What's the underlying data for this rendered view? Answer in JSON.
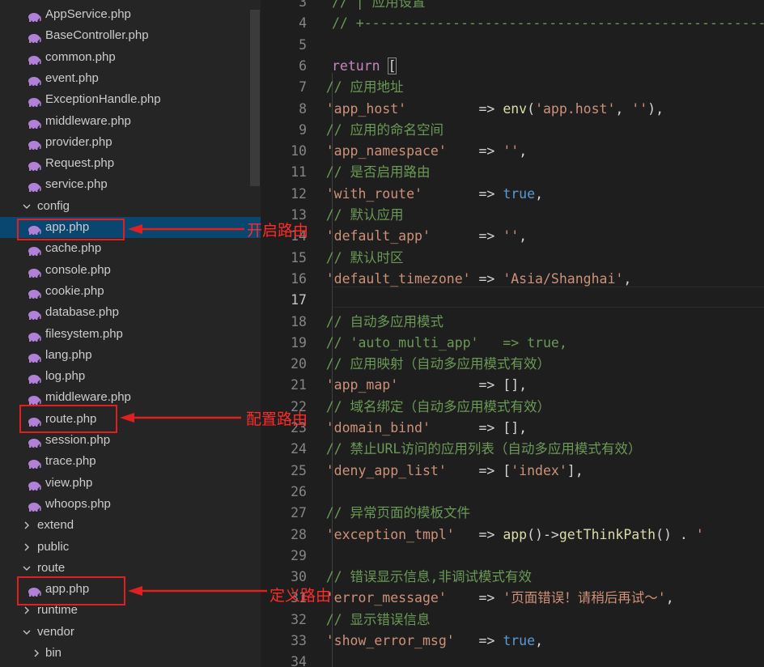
{
  "explorer": {
    "items": [
      {
        "label": "AppService.php",
        "type": "file",
        "depth": 2
      },
      {
        "label": "BaseController.php",
        "type": "file",
        "depth": 2
      },
      {
        "label": "common.php",
        "type": "file",
        "depth": 2
      },
      {
        "label": "event.php",
        "type": "file",
        "depth": 2
      },
      {
        "label": "ExceptionHandle.php",
        "type": "file",
        "depth": 2
      },
      {
        "label": "middleware.php",
        "type": "file",
        "depth": 2
      },
      {
        "label": "provider.php",
        "type": "file",
        "depth": 2
      },
      {
        "label": "Request.php",
        "type": "file",
        "depth": 2
      },
      {
        "label": "service.php",
        "type": "file",
        "depth": 2
      },
      {
        "label": "config",
        "type": "folder",
        "open": true,
        "depth": 1
      },
      {
        "label": "app.php",
        "type": "file",
        "depth": 2,
        "selected": true
      },
      {
        "label": "cache.php",
        "type": "file",
        "depth": 2
      },
      {
        "label": "console.php",
        "type": "file",
        "depth": 2
      },
      {
        "label": "cookie.php",
        "type": "file",
        "depth": 2
      },
      {
        "label": "database.php",
        "type": "file",
        "depth": 2
      },
      {
        "label": "filesystem.php",
        "type": "file",
        "depth": 2
      },
      {
        "label": "lang.php",
        "type": "file",
        "depth": 2
      },
      {
        "label": "log.php",
        "type": "file",
        "depth": 2
      },
      {
        "label": "middleware.php",
        "type": "file",
        "depth": 2
      },
      {
        "label": "route.php",
        "type": "file",
        "depth": 2
      },
      {
        "label": "session.php",
        "type": "file",
        "depth": 2
      },
      {
        "label": "trace.php",
        "type": "file",
        "depth": 2
      },
      {
        "label": "view.php",
        "type": "file",
        "depth": 2
      },
      {
        "label": "whoops.php",
        "type": "file",
        "depth": 2
      },
      {
        "label": "extend",
        "type": "folder",
        "open": false,
        "depth": 1
      },
      {
        "label": "public",
        "type": "folder",
        "open": false,
        "depth": 1
      },
      {
        "label": "route",
        "type": "folder",
        "open": true,
        "depth": 1
      },
      {
        "label": "app.php",
        "type": "file",
        "depth": 2
      },
      {
        "label": "runtime",
        "type": "folder",
        "open": false,
        "depth": 1
      },
      {
        "label": "vendor",
        "type": "folder",
        "open": true,
        "depth": 1
      },
      {
        "label": "bin",
        "type": "folder",
        "open": false,
        "depth": 2
      }
    ]
  },
  "editor": {
    "active_line": "17",
    "lines": [
      {
        "n": "3",
        "t": [
          [
            "c-cmt",
            "// | 应用设置"
          ]
        ]
      },
      {
        "n": "4",
        "t": [
          [
            "c-cmt",
            "// +----------------------------------------------------------------------"
          ]
        ]
      },
      {
        "n": "5",
        "t": []
      },
      {
        "n": "6",
        "t": [
          [
            "c-kw",
            "return"
          ],
          [
            "",
            "",
            " "
          ],
          [
            "bracket",
            "["
          ]
        ]
      },
      {
        "n": "7",
        "t": [
          [
            "",
            "    "
          ],
          [
            "c-cmt",
            "// 应用地址"
          ]
        ]
      },
      {
        "n": "8",
        "t": [
          [
            "",
            "    "
          ],
          [
            "c-str",
            "'app_host'"
          ],
          [
            "",
            "         => "
          ],
          [
            "c-fn",
            "env"
          ],
          [
            "",
            "("
          ],
          [
            "c-str",
            "'app.host'"
          ],
          [
            "",
            ", "
          ],
          [
            "c-str",
            "''"
          ],
          [
            "",
            "),"
          ]
        ]
      },
      {
        "n": "9",
        "t": [
          [
            "",
            "    "
          ],
          [
            "c-cmt",
            "// 应用的命名空间"
          ]
        ]
      },
      {
        "n": "10",
        "t": [
          [
            "",
            "    "
          ],
          [
            "c-str",
            "'app_namespace'"
          ],
          [
            "",
            "    => "
          ],
          [
            "c-str",
            "''"
          ],
          [
            "",
            ","
          ]
        ]
      },
      {
        "n": "11",
        "t": [
          [
            "",
            "    "
          ],
          [
            "c-cmt",
            "// 是否启用路由"
          ]
        ]
      },
      {
        "n": "12",
        "t": [
          [
            "",
            "    "
          ],
          [
            "c-str",
            "'with_route'"
          ],
          [
            "",
            "       => "
          ],
          [
            "c-bool",
            "true"
          ],
          [
            "",
            ","
          ]
        ]
      },
      {
        "n": "13",
        "t": [
          [
            "",
            "    "
          ],
          [
            "c-cmt",
            "// 默认应用"
          ]
        ]
      },
      {
        "n": "14",
        "t": [
          [
            "",
            "    "
          ],
          [
            "c-str",
            "'default_app'"
          ],
          [
            "",
            "      => "
          ],
          [
            "c-str",
            "''"
          ],
          [
            "",
            ","
          ]
        ]
      },
      {
        "n": "15",
        "t": [
          [
            "",
            "    "
          ],
          [
            "c-cmt",
            "// 默认时区"
          ]
        ]
      },
      {
        "n": "16",
        "t": [
          [
            "",
            "    "
          ],
          [
            "c-str",
            "'default_timezone'"
          ],
          [
            "",
            " => "
          ],
          [
            "c-str",
            "'Asia/Shanghai'"
          ],
          [
            "",
            ","
          ]
        ]
      },
      {
        "n": "17",
        "t": []
      },
      {
        "n": "18",
        "t": [
          [
            "",
            "    "
          ],
          [
            "c-cmt",
            "// 自动多应用模式"
          ]
        ]
      },
      {
        "n": "19",
        "t": [
          [
            "",
            "    "
          ],
          [
            "c-cmt",
            "// 'auto_multi_app'   => true,"
          ]
        ]
      },
      {
        "n": "20",
        "t": [
          [
            "",
            "    "
          ],
          [
            "c-cmt",
            "// 应用映射（自动多应用模式有效）"
          ]
        ]
      },
      {
        "n": "21",
        "t": [
          [
            "",
            "    "
          ],
          [
            "c-str",
            "'app_map'"
          ],
          [
            "",
            "          => [],"
          ]
        ]
      },
      {
        "n": "22",
        "t": [
          [
            "",
            "    "
          ],
          [
            "c-cmt",
            "// 域名绑定（自动多应用模式有效）"
          ]
        ]
      },
      {
        "n": "23",
        "t": [
          [
            "",
            "    "
          ],
          [
            "c-str",
            "'domain_bind'"
          ],
          [
            "",
            "      => [],"
          ]
        ]
      },
      {
        "n": "24",
        "t": [
          [
            "",
            "    "
          ],
          [
            "c-cmt",
            "// 禁止URL访问的应用列表（自动多应用模式有效）"
          ]
        ]
      },
      {
        "n": "25",
        "t": [
          [
            "",
            "    "
          ],
          [
            "c-str",
            "'deny_app_list'"
          ],
          [
            "",
            "    => ["
          ],
          [
            "c-str",
            "'index'"
          ],
          [
            "",
            "],"
          ]
        ]
      },
      {
        "n": "26",
        "t": []
      },
      {
        "n": "27",
        "t": [
          [
            "",
            "    "
          ],
          [
            "c-cmt",
            "// 异常页面的模板文件"
          ]
        ]
      },
      {
        "n": "28",
        "t": [
          [
            "",
            "    "
          ],
          [
            "c-str",
            "'exception_tmpl'"
          ],
          [
            "",
            "   => "
          ],
          [
            "c-fn",
            "app"
          ],
          [
            "",
            "()->"
          ],
          [
            "c-fn",
            "getThinkPath"
          ],
          [
            "",
            "() . "
          ],
          [
            "c-str",
            "'"
          ]
        ]
      },
      {
        "n": "29",
        "t": []
      },
      {
        "n": "30",
        "t": [
          [
            "",
            "    "
          ],
          [
            "c-cmt",
            "// 错误显示信息,非调试模式有效"
          ]
        ]
      },
      {
        "n": "31",
        "t": [
          [
            "",
            "    "
          ],
          [
            "c-str",
            "'error_message'"
          ],
          [
            "",
            "    => "
          ],
          [
            "c-str",
            "'页面错误！请稍后再试～'"
          ],
          [
            "",
            ","
          ]
        ]
      },
      {
        "n": "32",
        "t": [
          [
            "",
            "    "
          ],
          [
            "c-cmt",
            "// 显示错误信息"
          ]
        ]
      },
      {
        "n": "33",
        "t": [
          [
            "",
            "    "
          ],
          [
            "c-str",
            "'show_error_msg'"
          ],
          [
            "",
            "   => "
          ],
          [
            "c-bool",
            "true"
          ],
          [
            "",
            ","
          ]
        ]
      },
      {
        "n": "34",
        "t": []
      }
    ]
  },
  "annotations": {
    "enable_route": "开启路由",
    "config_route": "配置路由",
    "define_route": "定义路由"
  },
  "colors": {
    "highlight_red": "#e02020",
    "selection": "#094771",
    "php_icon": "#b180d7"
  }
}
